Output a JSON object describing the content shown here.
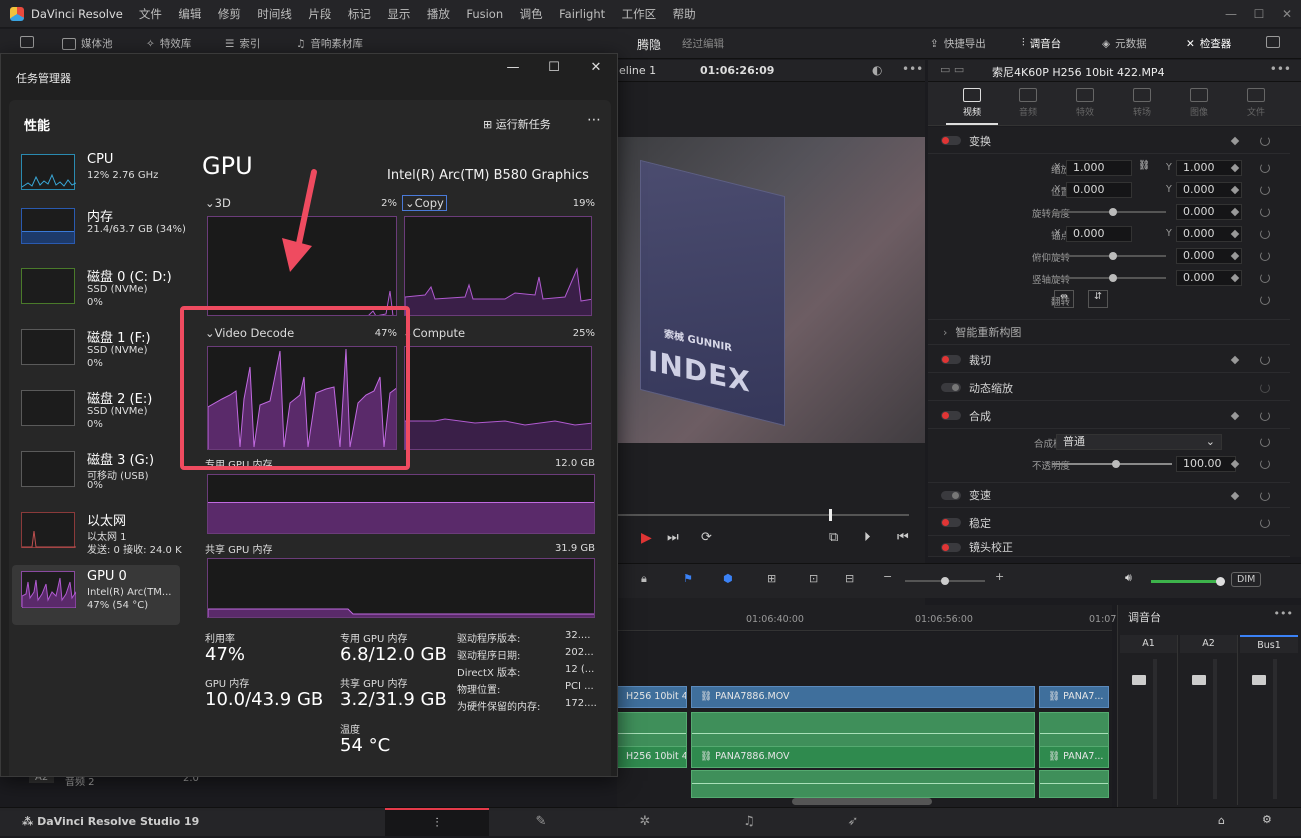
{
  "davinci": {
    "app_title": "DaVinci Resolve",
    "menu": [
      "文件",
      "编辑",
      "修剪",
      "时间线",
      "片段",
      "标记",
      "显示",
      "播放",
      "Fusion",
      "调色",
      "Fairlight",
      "工作区",
      "帮助"
    ],
    "toolbar": {
      "media_pool": "媒体池",
      "effects": "特效库",
      "index": "索引",
      "sound_library": "音响素材库",
      "center_title": "腾隐",
      "center_sub": "经过编辑",
      "quick_export": "快捷导出",
      "mixer": "调音台",
      "metadata": "元数据",
      "inspector": "检查器"
    },
    "viewer": {
      "timeline_name": "eline 1",
      "timecode": "01:06:26:09",
      "clip_title": "索尼4K60P H256 10bit 422.MP4",
      "logo_text": "INDEX",
      "logo_sub": "索械 GUNNIR"
    },
    "inspector": {
      "tabs": [
        "视频",
        "音频",
        "特效",
        "转场",
        "图像",
        "文件"
      ],
      "transform": "变换",
      "zoom": "缩放",
      "zoom_x": "1.000",
      "zoom_y": "1.000",
      "position": "位置",
      "pos_x": "0.000",
      "pos_y": "0.000",
      "rotation": "旋转角度",
      "rot": "0.000",
      "anchor": "锚点",
      "anc_x": "0.000",
      "anc_y": "0.000",
      "pitch": "俯仰旋转",
      "pitch_v": "0.000",
      "yaw": "竖轴旋转",
      "yaw_v": "0.000",
      "flip": "翻转",
      "smart_reframe": "智能重新构图",
      "crop": "裁切",
      "dynamic_zoom": "动态缩放",
      "composite": "合成",
      "comp_mode": "合成模式",
      "comp_mode_v": "普通",
      "opacity": "不透明度",
      "opacity_v": "100.00",
      "speed": "变速",
      "stabilize": "稳定",
      "lens": "镜头校正",
      "x": "X",
      "y": "Y"
    },
    "timeline": {
      "t1": "01:06:40:00",
      "t2": "01:06:56:00",
      "t3": "01:07",
      "clip_a": "H256 10bit 4...",
      "clip_b": "PANA7886.MOV",
      "clip_c": "PANA7...",
      "a2_label": "A2",
      "a2_name": "音频 2",
      "a2_val": "2.0",
      "dim": "DIM"
    },
    "mixer": {
      "title": "调音台",
      "channels": [
        "A1",
        "A2",
        "Bus1"
      ]
    },
    "bottom": {
      "brand": "DaVinci Resolve Studio 19"
    }
  },
  "taskmgr": {
    "title": "任务管理器",
    "section": "性能",
    "run_new_task": "运行新任务",
    "sidebar": [
      {
        "name": "CPU",
        "l2": "12% 2.76 GHz",
        "l3": ""
      },
      {
        "name": "内存",
        "l2": "21.4/63.7 GB (34%)",
        "l3": ""
      },
      {
        "name": "磁盘 0 (C: D:)",
        "l2": "SSD (NVMe)",
        "l3": "0%"
      },
      {
        "name": "磁盘 1 (F:)",
        "l2": "SSD (NVMe)",
        "l3": "0%"
      },
      {
        "name": "磁盘 2 (E:)",
        "l2": "SSD (NVMe)",
        "l3": "0%"
      },
      {
        "name": "磁盘 3 (G:)",
        "l2": "可移动 (USB)",
        "l3": "0%"
      },
      {
        "name": "以太网",
        "l2": "以太网 1",
        "l3": "发送: 0 接收: 24.0 K"
      },
      {
        "name": "GPU 0",
        "l2": "Intel(R) Arc(TM...",
        "l3": "47% (54 °C)"
      }
    ],
    "gpu": {
      "title": "GPU",
      "model": "Intel(R) Arc(TM) B580 Graphics",
      "g3d": "3D",
      "g3d_pct": "2%",
      "copy": "Copy",
      "copy_pct": "19%",
      "decode": "Video Decode",
      "decode_pct": "47%",
      "compute": "Compute",
      "compute_pct": "25%",
      "dedicated": "专用 GPU 内存",
      "dedicated_max": "12.0 GB",
      "shared": "共享 GPU 内存",
      "shared_max": "31.9 GB",
      "util_l": "利用率",
      "util_v": "47%",
      "dmem_l": "专用 GPU 内存",
      "dmem_v": "6.8/12.0 GB",
      "gmem_l": "GPU 内存",
      "gmem_v": "10.0/43.9 GB",
      "smem_l": "共享 GPU 内存",
      "smem_v": "3.2/31.9 GB",
      "temp_l": "温度",
      "temp_v": "54 °C",
      "info": [
        {
          "k": "驱动程序版本:",
          "v": "32...."
        },
        {
          "k": "驱动程序日期:",
          "v": "202..."
        },
        {
          "k": "DirectX 版本:",
          "v": "12 (..."
        },
        {
          "k": "物理位置:",
          "v": "PCI ..."
        },
        {
          "k": "为硬件保留的内存:",
          "v": "172...."
        }
      ]
    },
    "colors": {
      "accent": "#9a3fb0",
      "highlight": "#ef4b60"
    }
  }
}
